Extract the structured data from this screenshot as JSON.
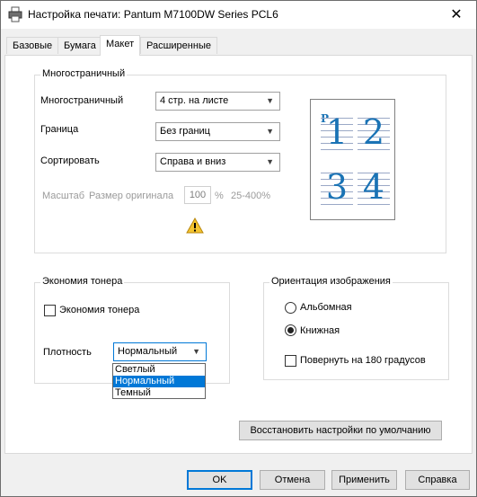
{
  "window": {
    "title": "Настройка печати: Pantum M7100DW Series PCL6",
    "close_glyph": "✕"
  },
  "tabs": [
    {
      "label": "Базовые",
      "active": false
    },
    {
      "label": "Бумага",
      "active": false
    },
    {
      "label": "Макет",
      "active": true
    },
    {
      "label": "Расширенные",
      "active": false
    }
  ],
  "multipage": {
    "group_title": "Многостраничный",
    "pages_label": "Многостраничный",
    "pages_value": "4 стр. на листе",
    "border_label": "Граница",
    "border_value": "Без границ",
    "order_label": "Сортировать",
    "order_value": "Справа и вниз",
    "scale_label": "Масштаб",
    "original_size_label": "Размер оригинала",
    "scale_value": "100",
    "percent": "%",
    "range": "25-400%",
    "warning_icon": "warning-icon",
    "preview": {
      "marker": "P",
      "pages": [
        "1",
        "2",
        "3",
        "4"
      ],
      "digit_color": "#1a73b5"
    }
  },
  "toner": {
    "group_title": "Экономия тонера",
    "checkbox_label": "Экономия тонера",
    "checked": false,
    "density_label": "Плотность",
    "density_value": "Нормальный",
    "density_options": [
      "Светлый",
      "Нормальный",
      "Темный"
    ],
    "density_selected": "Нормальный"
  },
  "orientation": {
    "group_title": "Ориентация изображения",
    "landscape_label": "Альбомная",
    "portrait_label": "Книжная",
    "selected": "Книжная",
    "rotate_label": "Повернуть на 180 градусов",
    "rotate_checked": false
  },
  "restore_label": "Восстановить настройки по умолчанию",
  "footer": {
    "ok": "OK",
    "cancel": "Отмена",
    "apply": "Применить",
    "help": "Справка"
  },
  "colors": {
    "accent": "#0078d7",
    "warning": "#f4c430"
  }
}
